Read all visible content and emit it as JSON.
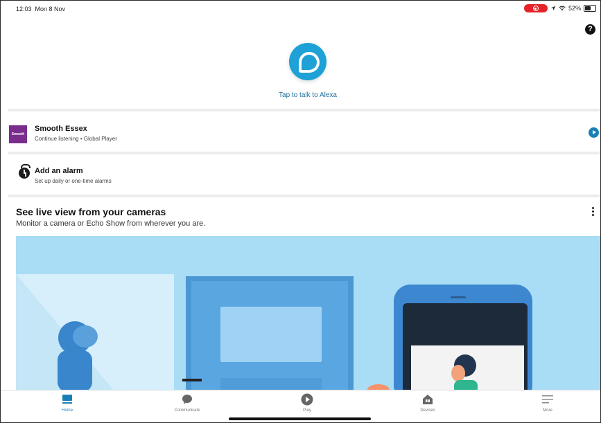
{
  "status_bar": {
    "time": "12:03",
    "date": "Mon 8 Nov",
    "battery": "52%"
  },
  "alexa": {
    "tap_text": "Tap to talk to Alexa"
  },
  "now_playing": {
    "title": "Smooth Essex",
    "subtitle": "Continue listening • Global Player",
    "thumb_text": "Smooth"
  },
  "alarm": {
    "title": "Add an alarm",
    "subtitle": "Set up daily or one-time alarms"
  },
  "cameras": {
    "title": "See live view from your cameras",
    "subtitle": "Monitor a camera or Echo Show from wherever you are."
  },
  "bottom_nav": {
    "home": "Home",
    "communicate": "Communicate",
    "play": "Play",
    "devices": "Devices",
    "more": "More"
  },
  "colors": {
    "accent": "#1a7fb5",
    "alexa_blue": "#1ea1d6",
    "illustration_bg": "#a9dcf5",
    "record_red": "#e5232a"
  },
  "icons": [
    "help-icon",
    "alexa-icon",
    "play-icon",
    "alarm-clock-icon",
    "kebab-menu-icon",
    "home-icon",
    "chat-bubble-icon",
    "play-circle-icon",
    "devices-house-icon",
    "hamburger-menu-icon",
    "location-arrow-icon",
    "wifi-icon",
    "battery-icon"
  ]
}
